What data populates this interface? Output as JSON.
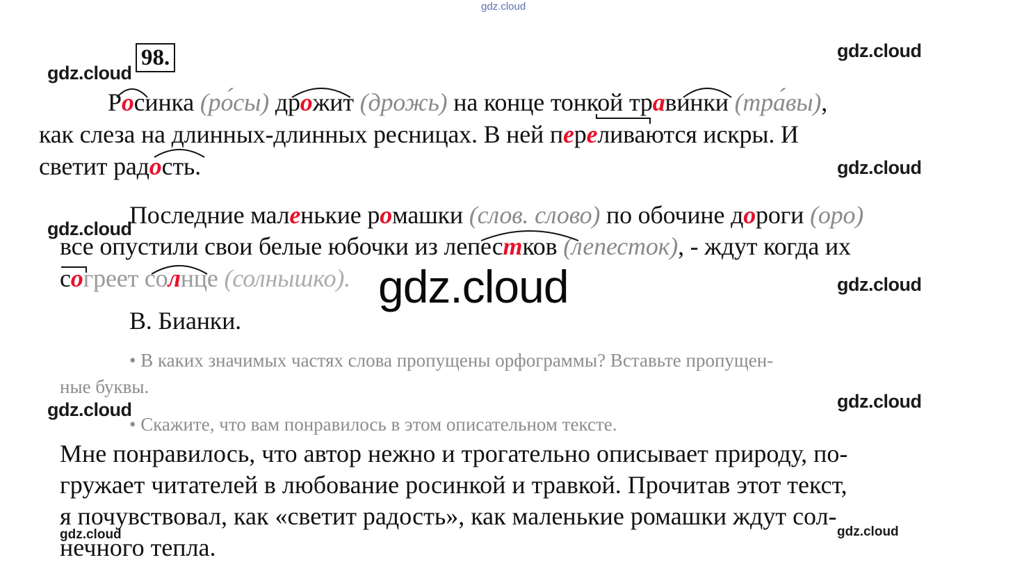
{
  "watermarks": {
    "top": "gdz.cloud",
    "center": "gdz.cloud",
    "side": "gdz.cloud"
  },
  "exercise_number": "98.",
  "paragraph1": {
    "l1": {
      "w1a": "Р",
      "w1b": "о",
      "w1c": "синка",
      "h1": "(ро́сы)",
      "w2a": "др",
      "w2b": "о",
      "w2c": "жит",
      "h2": "(дрожь)",
      "w3": "на конце тонкой",
      "w4a": "тр",
      "w4b": "а",
      "w4c": "винки",
      "h4": "(тра́вы)",
      "end": ","
    },
    "l2": {
      "t1": "как слеза на длинных-длинных ресницах. В ней п",
      "r1": "е",
      "t2": "р",
      "r2": "е",
      "t3": "ливаются искры. И"
    },
    "l3": {
      "t1": "светит рад",
      "r1": "о",
      "t2": "сть."
    }
  },
  "paragraph2": {
    "l1": {
      "t1": "Последние мал",
      "r1": "е",
      "t2": "нькие р",
      "r2": "о",
      "t3": "машки",
      "h1": "(слов. слово)",
      "t4": "по обочине д",
      "r3": "о",
      "t5": "роги",
      "h2": "(оро)"
    },
    "l2": {
      "t1": "все опустили свои белые юбочки из лепес",
      "r1": "т",
      "t2": "ков",
      "h1": "(лепесток)",
      "t3": ", - ждут когда их"
    },
    "l3": {
      "t1": "с",
      "r1": "о",
      "t2": "греет со",
      "r2": "л",
      "t3": "нце",
      "h1": "(солнышко)."
    }
  },
  "author": "В. Бианки.",
  "questions": {
    "q1_l1": "• В каких значимых частях слова пропущены орфограммы? Вставьте пропущен-",
    "q1_l2": "ные буквы.",
    "q2": "• Скажите, что вам понравилось в этом описательном тексте."
  },
  "answer": {
    "l1": "Мне понравилось, что автор нежно и трогательно описывает природу, по-",
    "l2": "гружает читателей в любование росинкой и травкой. Прочитав этот текст,",
    "l3": "я почувствовал, как «светит радость», как маленькие ромашки ждут сол-",
    "l4": "нечного тепла."
  },
  "colors": {
    "text": "#111111",
    "highlight": "#e8102a",
    "hint": "#8a8a8a"
  }
}
